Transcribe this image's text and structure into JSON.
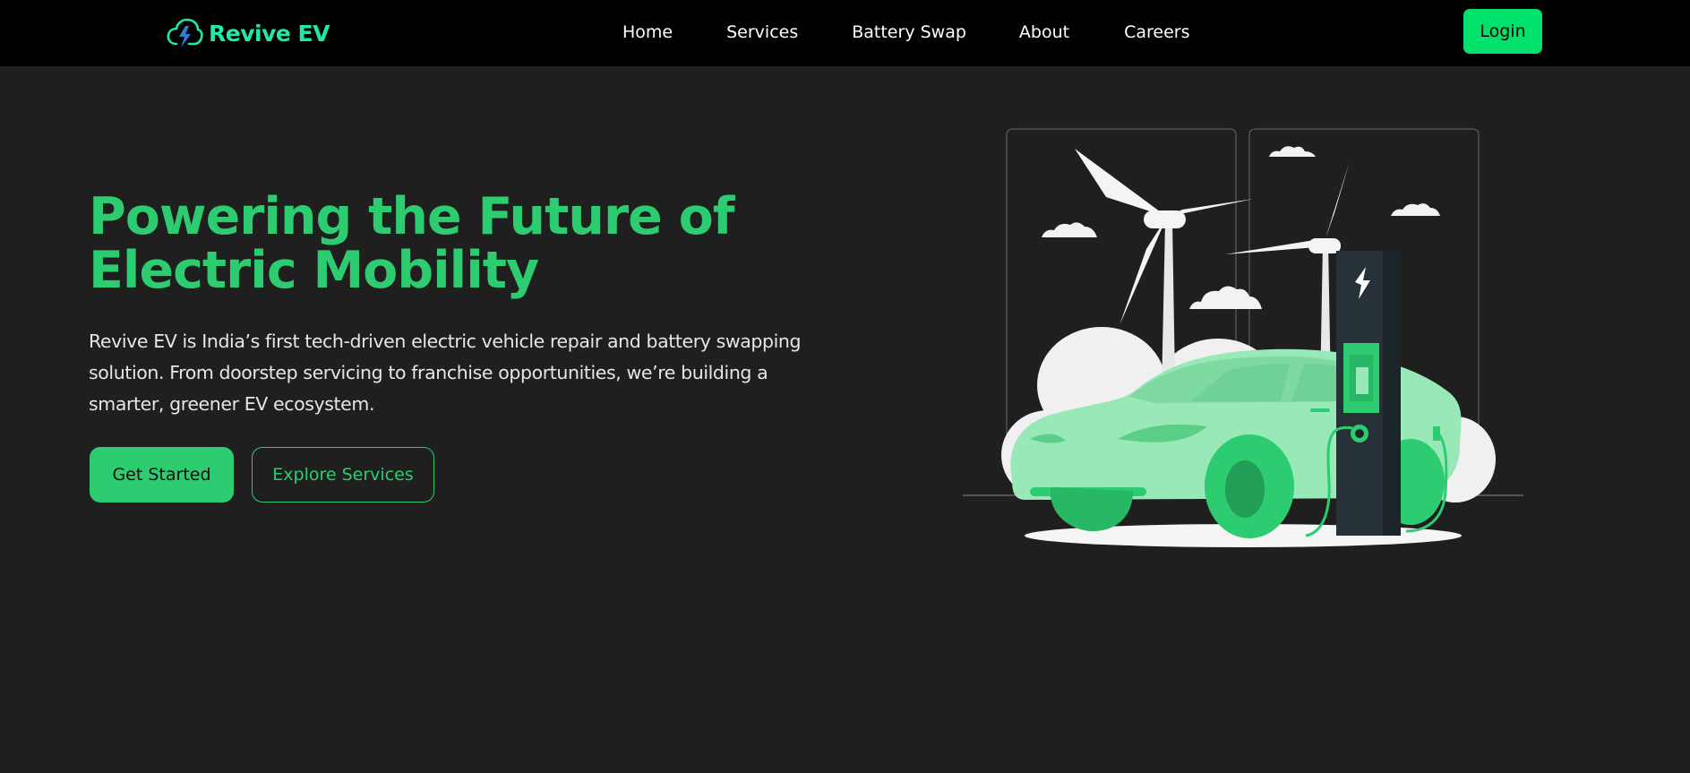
{
  "brand": {
    "name": "Revive EV",
    "logo_icon": "lightning-cloud-icon",
    "color": "#1de9a8"
  },
  "nav": {
    "links": [
      {
        "label": "Home"
      },
      {
        "label": "Services"
      },
      {
        "label": "Battery Swap"
      },
      {
        "label": "About"
      },
      {
        "label": "Careers"
      }
    ],
    "login_label": "Login"
  },
  "hero": {
    "title": "Powering the Future of Electric Mobility",
    "description": "Revive EV is India’s first tech-driven electric vehicle repair and battery swapping solution. From doorstep servicing to franchise opportunities, we’re building a smarter, greener EV ecosystem.",
    "primary_cta": "Get Started",
    "secondary_cta": "Explore Services",
    "illustration": "ev-charging-station-illustration"
  },
  "colors": {
    "background": "#1f1f1f",
    "navbar": "#000000",
    "accent": "#2ecc71",
    "login": "#00e26b"
  }
}
